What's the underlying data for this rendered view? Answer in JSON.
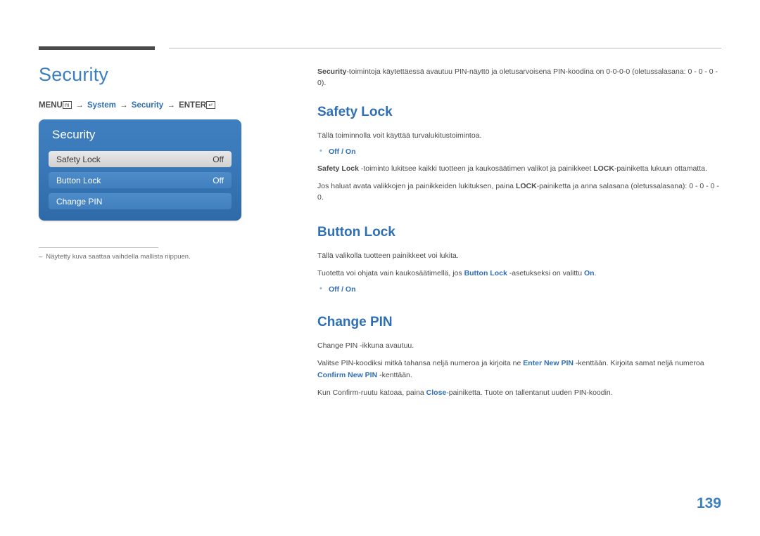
{
  "header": {
    "rule_left_color": "#4a4a4a",
    "rule_right_color": "#b9b9b9"
  },
  "left": {
    "title": "Security",
    "menu_path": {
      "menu_label": "MENU",
      "menu_icon": "m",
      "arrow": "→",
      "item1": "System",
      "item2": "Security",
      "enter_label": "ENTER",
      "enter_icon": "↵"
    },
    "osd": {
      "title": "Security",
      "rows": [
        {
          "label": "Safety Lock",
          "value": "Off",
          "state": "selected"
        },
        {
          "label": "Button Lock",
          "value": "Off",
          "state": "dim"
        },
        {
          "label": "Change PIN",
          "value": "",
          "state": "dim"
        }
      ]
    },
    "footnote": {
      "dash": "–",
      "text": "Näytetty kuva saattaa vaihdella mallista riippuen."
    }
  },
  "right": {
    "intro": {
      "bold_lead": "Security",
      "rest": "-toimintoja käytettäessä avautuu PIN-näyttö ja oletusarvoisena PIN-koodina on 0-0-0-0 (oletussalasana: 0 - 0 - 0 - 0)."
    },
    "sections": [
      {
        "title": "Safety Lock",
        "paragraphs": [
          {
            "text": "Tällä toiminnolla voit käyttää turvalukitustoimintoa."
          }
        ],
        "bullet": "Off / On",
        "after_bullet": [
          {
            "pre_bold": "Safety Lock",
            "text": " -toiminto lukitsee kaikki tuotteen ja kaukosäätimen valikot ja painikkeet ",
            "mid_bold": "LOCK",
            "post": "-painiketta lukuun ottamatta."
          },
          {
            "text_a": "Jos haluat avata valikkojen ja painikkeiden lukituksen, paina ",
            "bold": "LOCK",
            "text_b": "-painiketta ja anna salasana (oletussalasana): 0 - 0 - 0 - 0."
          }
        ]
      },
      {
        "title": "Button Lock",
        "paragraphs": [
          {
            "text": "Tällä valikolla tuotteen painikkeet voi lukita."
          },
          {
            "text_a": "Tuotetta voi ohjata vain kaukosäätimellä, jos ",
            "blue": "Button Lock",
            "text_b": " -asetukseksi on valittu ",
            "blue2": "On",
            "text_c": "."
          }
        ],
        "bullet": "Off / On"
      },
      {
        "title": "Change PIN",
        "paragraphs": [
          {
            "text": "Change PIN -ikkuna avautuu."
          },
          {
            "text_a": "Valitse PIN-koodiksi mitkä tahansa neljä numeroa ja kirjoita ne ",
            "blue": "Enter New PIN",
            "text_b": " -kenttään. Kirjoita samat neljä numeroa ",
            "blue2": "Confirm New PIN",
            "text_c": " -kenttään."
          },
          {
            "text_a": "Kun Confirm-ruutu katoaa, paina ",
            "blue": "Close",
            "text_b": "-painiketta. Tuote on tallentanut uuden PIN-koodin."
          }
        ]
      }
    ]
  },
  "page_number": "139"
}
